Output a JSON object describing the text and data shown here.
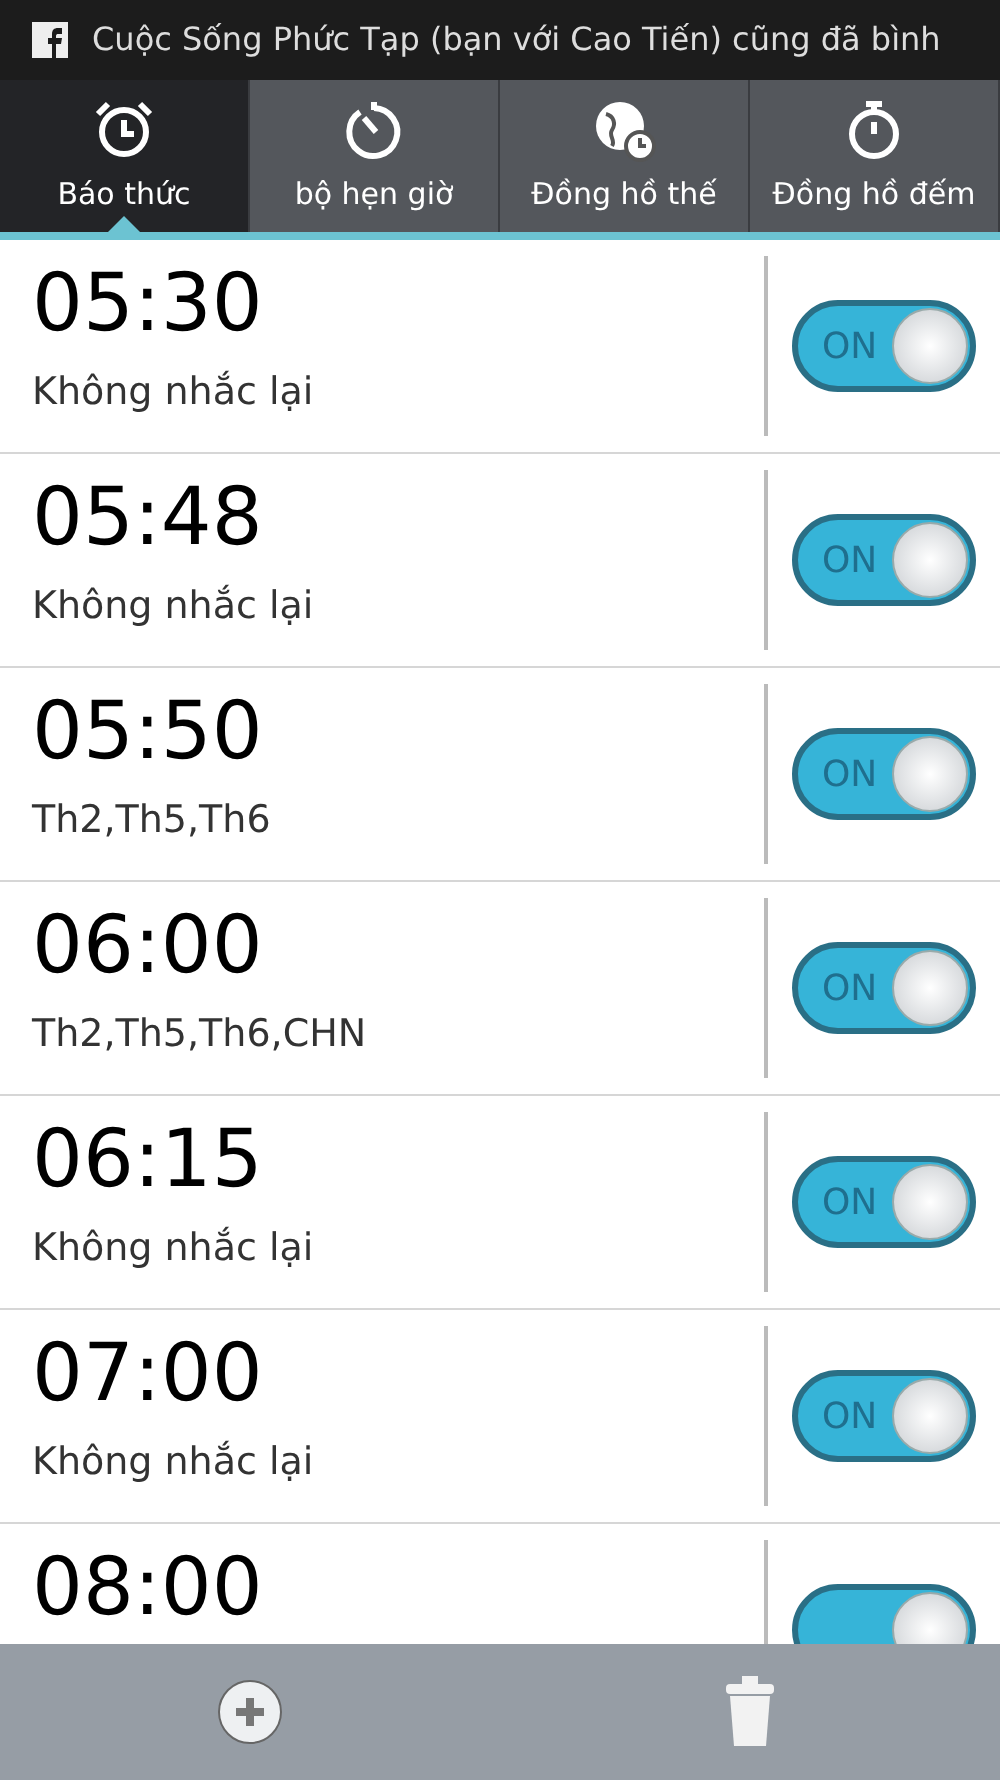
{
  "status_bar": {
    "notification": "Cuộc Sống Phức Tạp (bạn với Cao Tiến) cũng đã bình"
  },
  "tabs": [
    {
      "label": "Báo thức",
      "kind": "alarm",
      "selected": true
    },
    {
      "label": "bộ hẹn giờ",
      "kind": "timer",
      "selected": false
    },
    {
      "label": "Đồng hồ thế",
      "kind": "world",
      "selected": false
    },
    {
      "label": "Đồng hồ đếm",
      "kind": "stopwatch",
      "selected": false
    }
  ],
  "alarms": [
    {
      "time": "05:30",
      "repeat": "Không nhắc lại",
      "on": true,
      "switch_label": "ON"
    },
    {
      "time": "05:48",
      "repeat": "Không nhắc lại",
      "on": true,
      "switch_label": "ON"
    },
    {
      "time": "05:50",
      "repeat": "Th2,Th5,Th6",
      "on": true,
      "switch_label": "ON"
    },
    {
      "time": "06:00",
      "repeat": "Th2,Th5,Th6,CHN",
      "on": true,
      "switch_label": "ON"
    },
    {
      "time": "06:15",
      "repeat": "Không nhắc lại",
      "on": true,
      "switch_label": "ON"
    },
    {
      "time": "07:00",
      "repeat": "Không nhắc lại",
      "on": true,
      "switch_label": "ON"
    },
    {
      "time": "08:00",
      "on": true
    }
  ]
}
